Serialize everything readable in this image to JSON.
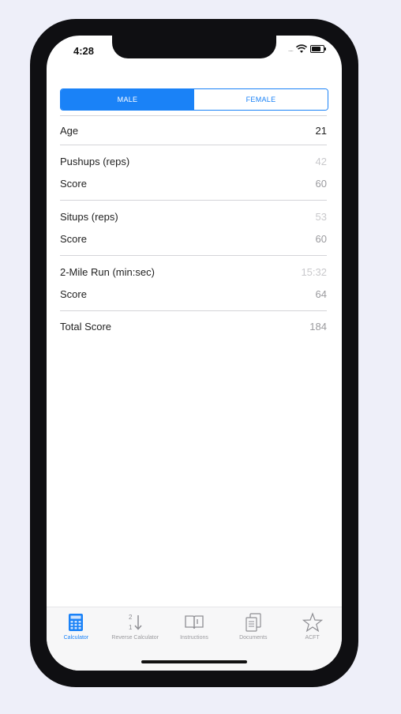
{
  "status": {
    "time": "4:28",
    "signal": "....."
  },
  "segmented": {
    "male": "MALE",
    "female": "FEMALE",
    "selected": "MALE"
  },
  "rows": {
    "age": {
      "label": "Age",
      "value": "21"
    },
    "pushups": {
      "label": "Pushups (reps)",
      "value": "42"
    },
    "pushups_score": {
      "label": "Score",
      "value": "60"
    },
    "situps": {
      "label": "Situps (reps)",
      "value": "53"
    },
    "situps_score": {
      "label": "Score",
      "value": "60"
    },
    "run": {
      "label": "2-Mile Run (min:sec)",
      "value": "15:32"
    },
    "run_score": {
      "label": "Score",
      "value": "64"
    },
    "total": {
      "label": "Total Score",
      "value": "184"
    }
  },
  "tabbar": {
    "calculator": "Calculator",
    "reverse": "Reverse Calculator",
    "instructions": "Instructions",
    "documents": "Documents",
    "acft": "ACFT"
  },
  "colors": {
    "accent": "#1A82F7",
    "background": "#EEEFF9",
    "frame": "#0F0F12"
  }
}
